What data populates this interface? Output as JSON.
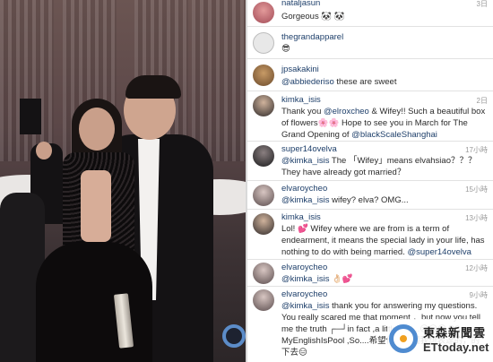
{
  "photo": {
    "description_icon": "party-photo"
  },
  "comments": [
    {
      "user": "nataljasun",
      "time": "3日",
      "text": "Gorgeous 🐼 🐼",
      "avatar": "avatar-pink"
    },
    {
      "user": "thegrandapparel",
      "time": "",
      "text": "😎",
      "avatar": "avatar-badge"
    },
    {
      "user": "jpsakakini",
      "time": "",
      "text_mention": "@abbiederiso",
      "text_rest": " these are sweet",
      "avatar": "avatar-brown"
    },
    {
      "user": "kimka_isis",
      "time": "2日",
      "text_a": "Thank you ",
      "text_m1": "@elroxcheo",
      "text_b": " & Wifey!! Such a beautiful box of flowers🌸🌸 Hope to see you in March for The Grand  Opening of ",
      "text_m2": "@blackScaleShanghai",
      "avatar": "avatar-man"
    },
    {
      "user": "super14ovelva",
      "time": "17小時",
      "text_mention": "@kimka_isis",
      "text_rest": " The 「Wifey」means elvahsiao？？？ They have already got married？",
      "avatar": "avatar-dark"
    },
    {
      "user": "elvaroycheo",
      "time": "15小時",
      "text_mention": "@kimka_isis",
      "text_rest": " wifey? elva? OMG...",
      "avatar": "avatar-light"
    },
    {
      "user": "kimka_isis",
      "time": "13小時",
      "text_a": "Lol! 💕 Wifey where we are from is a term of endearment, it means the special lady in your life, has nothing to do with being married. ",
      "text_m1": "@super14ovelva",
      "avatar": "avatar-man"
    },
    {
      "user": "elvaroycheo",
      "time": "12小時",
      "text_mention": "@kimka_isis",
      "text_rest": " 👌🏻💕",
      "avatar": "avatar-light"
    },
    {
      "user": "elvaroycheo",
      "time": "9小時",
      "text_mention": "@kimka_isis",
      "text_rest": "  thank you for answering my questions. You really scared me that moment ．but now you tell me the truth ┌─┘in fact ,a little lost...😑😑😑 PS: MyEnglishIsPool ,So....希望你能看懂我想表達的，的下去😑",
      "avatar": "avatar-light"
    }
  ],
  "watermark": {
    "cn": "東森新聞雲",
    "en": "ETtoday.net"
  },
  "colors": {
    "username": "#1e3f6a",
    "mention": "#1e3f6a",
    "time": "#9a9a9a",
    "logo": "#4f8bd0"
  }
}
